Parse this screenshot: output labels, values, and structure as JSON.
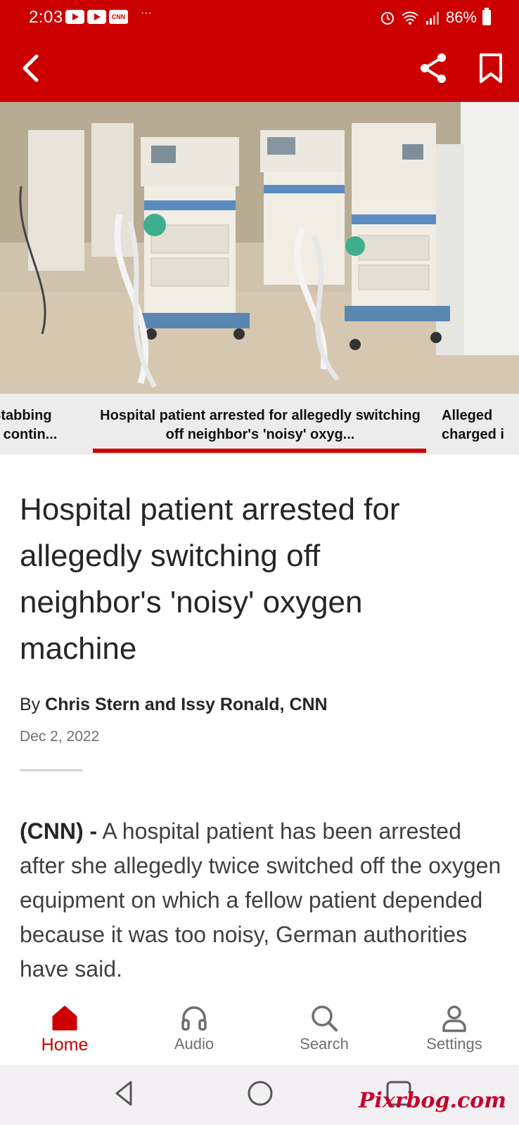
{
  "status_bar": {
    "time": "2:03",
    "battery": "86%",
    "app_icon_text": "CNN",
    "more": "···"
  },
  "top_bar": {
    "back": "back-arrow-icon",
    "share": "share-icon",
    "bookmark": "bookmark-icon"
  },
  "story_tabs": {
    "prev": "Stabbing\ns contin...",
    "current": "Hospital patient arrested for allegedly switching off neighbor's 'noisy' oxyg...",
    "next": "Alleged\ncharged i"
  },
  "article": {
    "headline": "Hospital patient arrested for allegedly switching off neighbor's 'noisy' oxygen machine",
    "byline_prefix": "By",
    "authors": "Chris Stern and Issy Ronald, CNN",
    "date": "Dec 2, 2022",
    "lead": "(CNN) -",
    "body": " A hospital patient has been arrested after she allegedly twice switched off the oxygen equipment on which a fellow patient depended because it was too noisy, German authorities have said."
  },
  "bottom_nav": [
    {
      "label": "Home",
      "icon": "home-icon",
      "active": true
    },
    {
      "label": "Audio",
      "icon": "headphones-icon",
      "active": false
    },
    {
      "label": "Search",
      "icon": "search-icon",
      "active": false
    },
    {
      "label": "Settings",
      "icon": "person-icon",
      "active": false
    }
  ],
  "watermark": "Pixrbog.com",
  "colors": {
    "brand": "#cc0000",
    "nav_inactive": "#6e6e6e",
    "tab_bg": "#ececec"
  }
}
